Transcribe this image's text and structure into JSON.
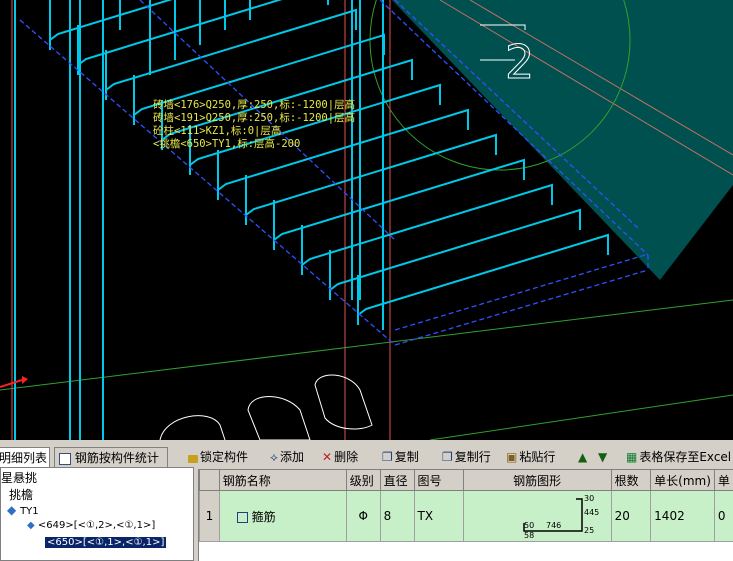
{
  "viewport": {
    "tooltip_lines": [
      "砖墙<176>Q250,厚:250,标:-1200|层高",
      "砖墙<191>Q250,厚:250,标:-1200|层高",
      "砼柱<111>KZ1,标:0|层高",
      "<挑檐<650>TY1,标:层高-200"
    ],
    "axis_label": "2",
    "colors": {
      "rebar": "#00c8e8",
      "outline": "#3050ff",
      "grid_green": "#30a030",
      "wall_red": "#e05050",
      "slab": "#005050"
    }
  },
  "tabs": [
    {
      "label": "明细列表",
      "icon": "list-icon"
    },
    {
      "label": "钢筋按构件统计",
      "icon": "table-icon"
    }
  ],
  "toolbar": {
    "lock": "锁定构件",
    "add": "添加",
    "delete": "删除",
    "copy": "复制",
    "copy_row": "复制行",
    "paste_row": "粘贴行",
    "save_excel": "表格保存至Excel"
  },
  "tree": {
    "nodes": [
      "星悬挑",
      "挑檐",
      "TY1",
      "<649>[<①,2>,<①,1>]",
      "<650>[<①,1>,<①,1>]"
    ]
  },
  "table": {
    "headers": [
      "",
      "钢筋名称",
      "级别",
      "直径",
      "图号",
      "钢筋图形",
      "根数",
      "单长(mm)",
      "单"
    ],
    "rows": [
      {
        "index": "1",
        "name": "箍筋",
        "grade": "Φ",
        "diameter": "8",
        "figure_no": "TX",
        "count": "20",
        "length": "1402",
        "extra": "0"
      }
    ],
    "shape_labels": {
      "top": "30",
      "right": "445",
      "bottom_mid": "746",
      "left_dim": "50",
      "left_low": "58",
      "right_low": "25"
    }
  }
}
